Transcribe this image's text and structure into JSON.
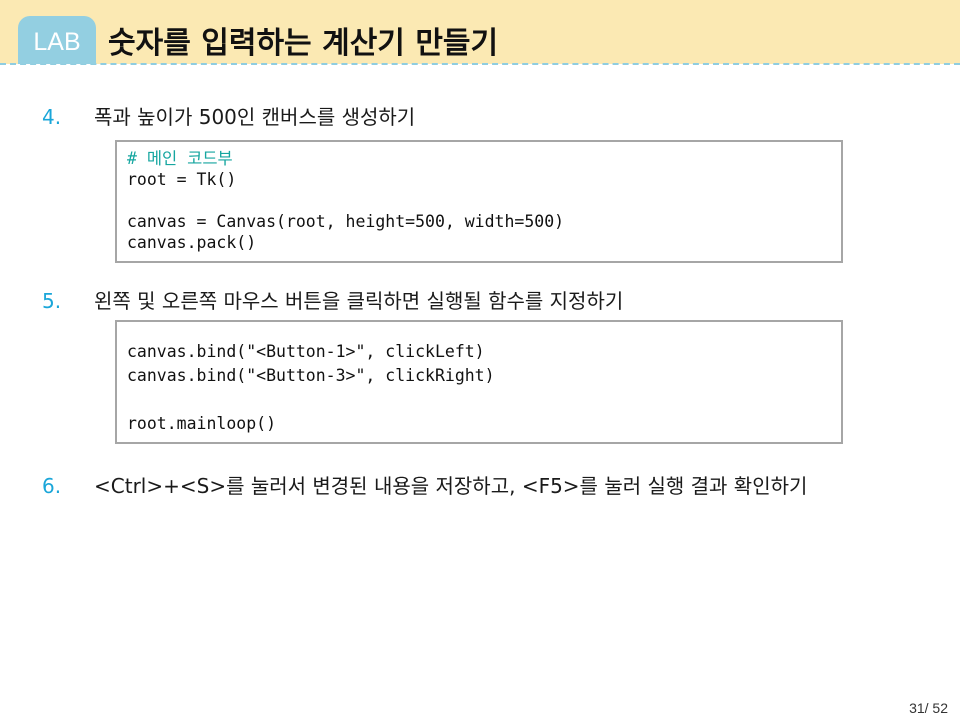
{
  "header": {
    "badge": "LAB",
    "title": "숫자를 입력하는 계산기 만들기"
  },
  "steps": [
    {
      "num": "4.",
      "text": "폭과 높이가 500인 캔버스를 생성하기"
    },
    {
      "num": "5.",
      "text": "왼쪽 및 오른쪽 마우스 버튼을 클릭하면 실행될 함수를 지정하기"
    },
    {
      "num": "6.",
      "text": "<Ctrl>+<S>를 눌러서 변경된 내용을 저장하고, <F5>를 눌러 실행 결과 확인하기"
    }
  ],
  "code_blocks": [
    {
      "comment": "# 메인 코드부",
      "lines": [
        "root = Tk()",
        "",
        "canvas = Canvas(root, height=500, width=500)",
        "canvas.pack()"
      ]
    },
    {
      "lines": [
        "",
        "canvas.bind(\"<Button-1>\", clickLeft)",
        "canvas.bind(\"<Button-3>\", clickRight)",
        "",
        "root.mainloop()"
      ]
    }
  ],
  "colors": {
    "header_band": "#fbe9b3",
    "badge": "#93cfe1",
    "step_number": "#1aa6d9",
    "comment": "#16a6a0"
  },
  "footer": {
    "page": "31/ 52"
  }
}
